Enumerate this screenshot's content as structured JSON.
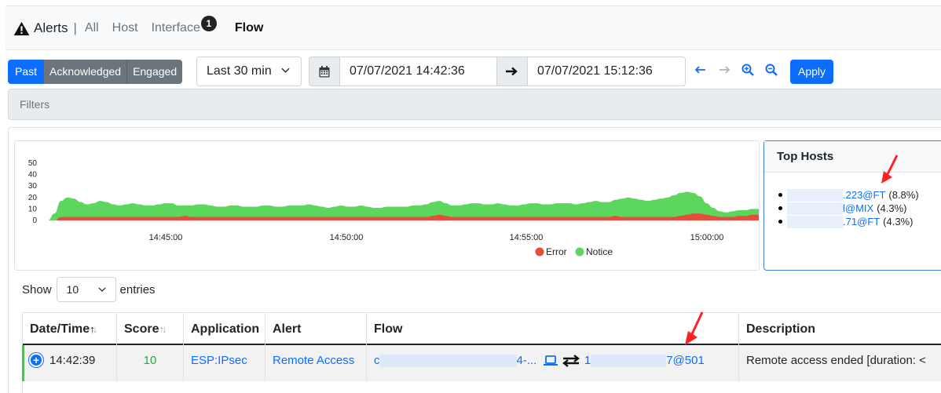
{
  "nav": {
    "title": "Alerts",
    "separator": "|",
    "links": [
      "All",
      "Host",
      "Interface",
      "Flow"
    ],
    "interface_badge": "1",
    "active": "Flow"
  },
  "toolbar": {
    "status_buttons": [
      "Past",
      "Acknowledged",
      "Engaged"
    ],
    "range": "Last 30 min",
    "date_from": "07/07/2021 14:42:36",
    "date_to": "07/07/2021 15:12:36",
    "apply_label": "Apply"
  },
  "filters_label": "Filters",
  "chart_data": {
    "type": "area",
    "x": [
      "14:45:00",
      "14:50:00",
      "14:55:00",
      "15:00:00"
    ],
    "yticks": [
      0,
      10,
      20,
      30,
      40,
      50
    ],
    "ylim": [
      0,
      50
    ],
    "series": [
      {
        "name": "Error",
        "color": "#e74c3c",
        "values": [
          0,
          0,
          3,
          3,
          3,
          3,
          3,
          3,
          3,
          3,
          3,
          3,
          3,
          3,
          3,
          3,
          3,
          3,
          3,
          3,
          3,
          4,
          3,
          3,
          3,
          3,
          3,
          3,
          3,
          3,
          3,
          3,
          3,
          3,
          3,
          3,
          3,
          3,
          3,
          3,
          3,
          3,
          3,
          3,
          3,
          3,
          3,
          3,
          3,
          3,
          3,
          3,
          3,
          3,
          3,
          3,
          3,
          3,
          3,
          4,
          5,
          4,
          3,
          3,
          3,
          3,
          3,
          3,
          3,
          3,
          3,
          3,
          3,
          3,
          3,
          3,
          3,
          3,
          3,
          3,
          3,
          3,
          3,
          3,
          3,
          3,
          3,
          4,
          3,
          3,
          3,
          3,
          3,
          3,
          3,
          3,
          3,
          4,
          5,
          6,
          6,
          5,
          4,
          3,
          3,
          3,
          4,
          4,
          5,
          5
        ]
      },
      {
        "name": "Notice",
        "color": "#5cd65c",
        "values": [
          0,
          6,
          14,
          17,
          16,
          13,
          11,
          12,
          14,
          13,
          11,
          10,
          11,
          12,
          11,
          10,
          10,
          11,
          12,
          12,
          10,
          9,
          10,
          11,
          11,
          10,
          9,
          9,
          10,
          10,
          9,
          9,
          9,
          10,
          10,
          9,
          9,
          10,
          10,
          10,
          11,
          10,
          9,
          8,
          9,
          10,
          9,
          9,
          10,
          9,
          8,
          8,
          9,
          9,
          9,
          9,
          10,
          10,
          11,
          12,
          12,
          11,
          10,
          10,
          11,
          12,
          12,
          11,
          11,
          12,
          11,
          10,
          10,
          11,
          12,
          12,
          11,
          11,
          12,
          12,
          12,
          11,
          12,
          13,
          14,
          13,
          13,
          14,
          16,
          17,
          16,
          15,
          14,
          15,
          16,
          17,
          19,
          20,
          20,
          18,
          15,
          10,
          7,
          5,
          4,
          5,
          5,
          5,
          5,
          5
        ]
      }
    ],
    "legend": [
      "Error",
      "Notice"
    ],
    "legend_position": "bottom"
  },
  "top_hosts": {
    "title": "Top Hosts",
    "items": [
      {
        "name": ".223@FT",
        "pct": "(8.8%)"
      },
      {
        "name": "l@MIX",
        "pct": "(4.3%)"
      },
      {
        "name": ".71@FT",
        "pct": "(4.3%)"
      }
    ]
  },
  "entries": {
    "show_label": "Show",
    "value": "10",
    "suffix": "entries"
  },
  "table": {
    "columns": [
      "Date/Time",
      "Score",
      "Application",
      "Alert",
      "Flow",
      "Description"
    ],
    "rows": [
      {
        "time": "14:42:39",
        "score": "10",
        "application": "ESP:IPsec",
        "alert": "Remote Access",
        "flow_src_prefix": "c",
        "flow_src_suffix": "4-...",
        "flow_dst_prefix": "1",
        "flow_dst_suffix": "7@501",
        "description": "Remote access ended [duration: <"
      }
    ]
  }
}
